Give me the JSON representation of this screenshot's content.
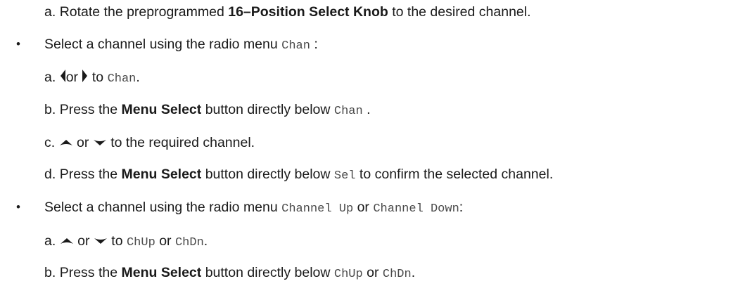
{
  "steps": {
    "knob": {
      "marker": "a.",
      "t1": "Rotate the preprogrammed ",
      "bold": "16–Position Select Knob",
      "t2": " to the desired channel."
    },
    "chan": {
      "bullet": "•",
      "t1": "Select a channel using the radio menu ",
      "code": "Chan",
      "t2": " :",
      "a": {
        "marker": "a.",
        "or": "or",
        "t1": " to ",
        "code": "Chan",
        "t2": "."
      },
      "b": {
        "marker": "b.",
        "t1": "Press the ",
        "bold": "Menu Select",
        "t2": " button directly below ",
        "code": "Chan",
        "t3": " ."
      },
      "c": {
        "marker": "c.",
        "or": " or ",
        "t1": " to the required channel."
      },
      "d": {
        "marker": "d.",
        "t1": "Press the ",
        "bold": "Menu Select",
        "t2": " button directly below ",
        "code": "Sel",
        "t3": " to confirm the selected channel."
      }
    },
    "updown": {
      "bullet": "•",
      "t1": "Select a channel using the radio menu ",
      "code1": "Channel Up",
      "or": " or ",
      "code2": "Channel Down",
      "t2": ":",
      "a": {
        "marker": "a.",
        "or1": " or ",
        "t1": " to ",
        "code1": "ChUp",
        "or2": " or ",
        "code2": "ChDn",
        "t2": "."
      },
      "b": {
        "marker": "b.",
        "t1": "Press the ",
        "bold": "Menu Select",
        "t2": " button directly below ",
        "code1": "ChUp",
        "or": " or ",
        "code2": "ChDn",
        "t3": "."
      }
    }
  },
  "icons": {
    "left": "left-arrow-icon",
    "right": "right-arrow-icon",
    "up": "up-arrow-icon",
    "down": "down-arrow-icon"
  }
}
